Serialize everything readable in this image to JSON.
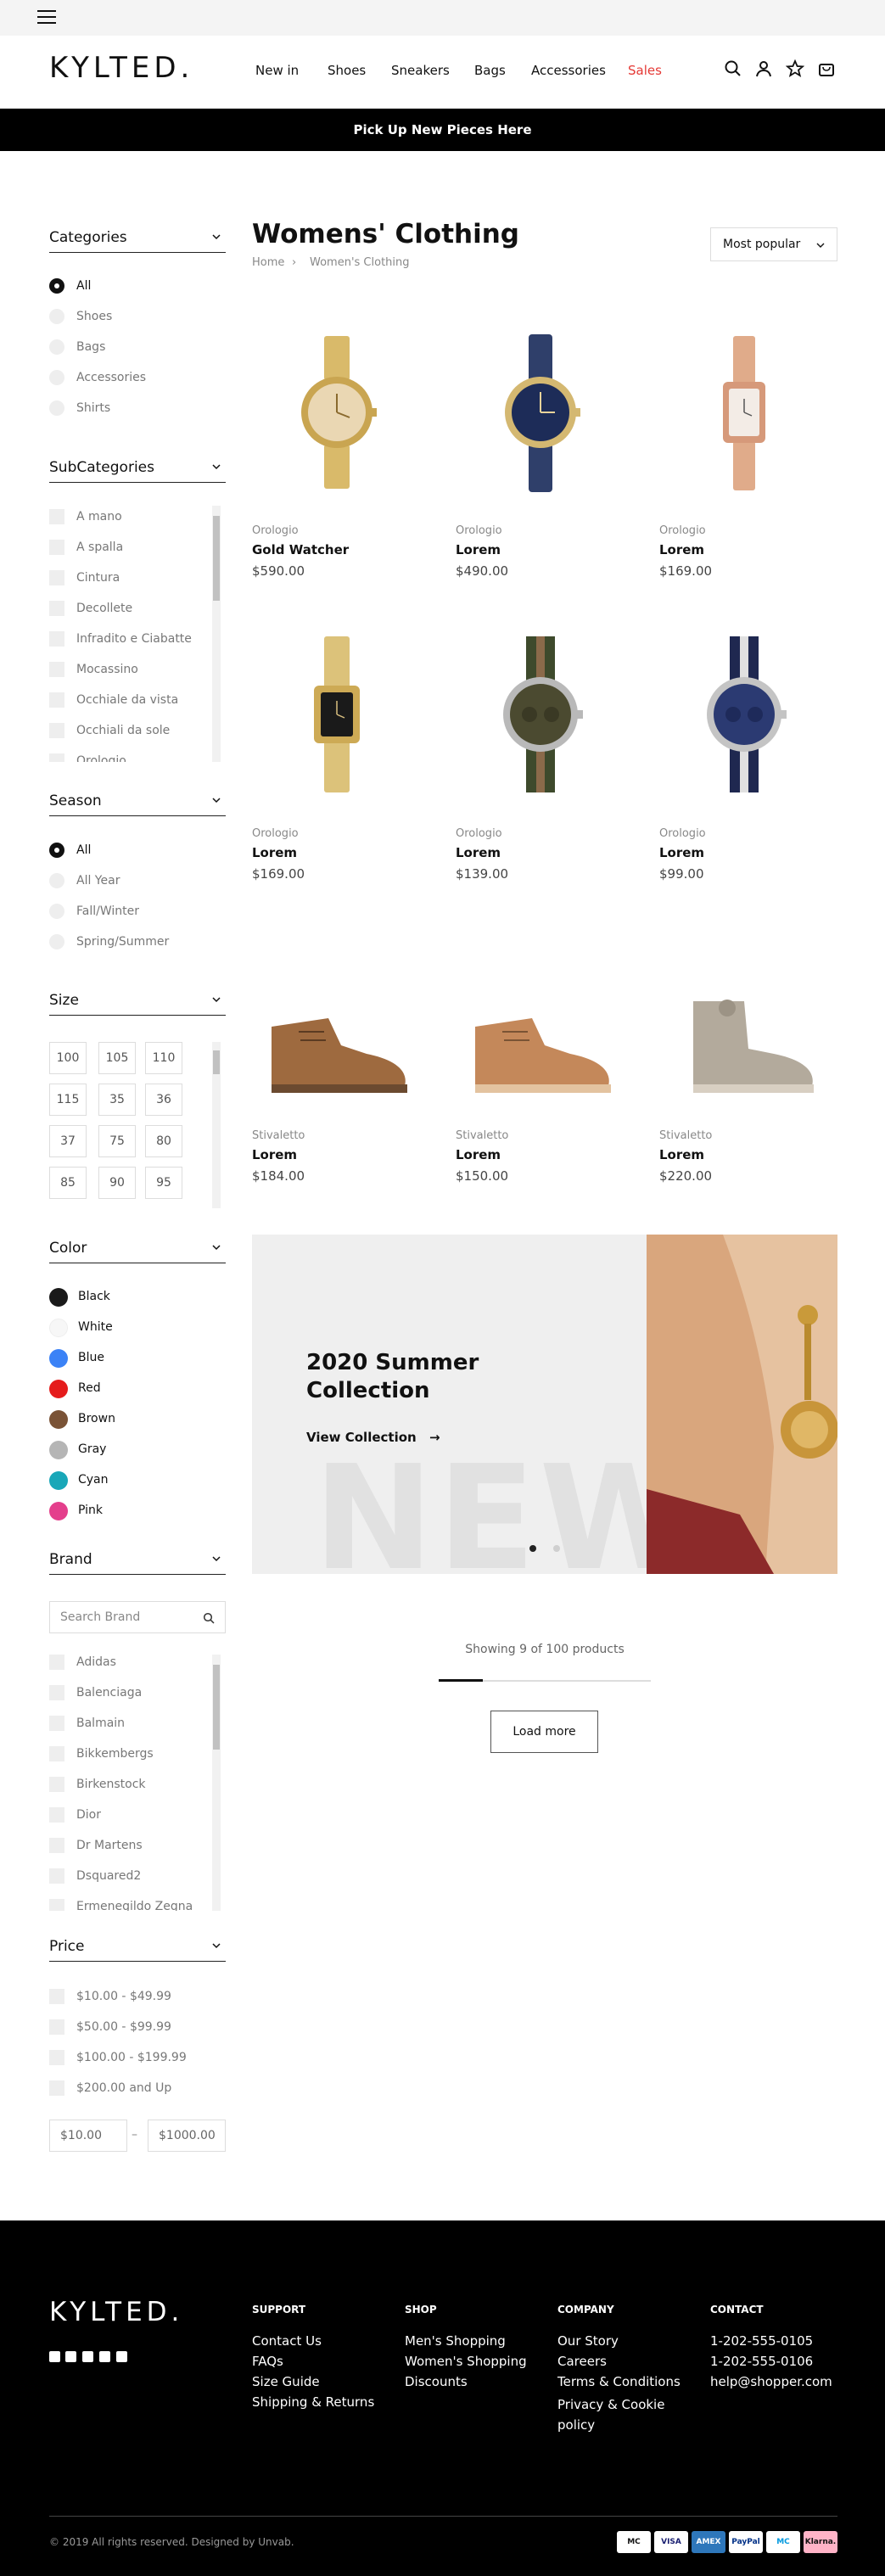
{
  "brand": {
    "logo": "KYLTED."
  },
  "nav": {
    "items": [
      "New in",
      "Shoes",
      "Sneakers",
      "Bags",
      "Accessories"
    ],
    "sales": "Sales",
    "sales_color": "#e53935"
  },
  "header_icons": [
    "search-icon",
    "user-icon",
    "star-icon",
    "bag-icon"
  ],
  "promo": {
    "text": "Pick Up New Pieces Here"
  },
  "filters": {
    "categories": {
      "title": "Categories",
      "options": [
        "All",
        "Shoes",
        "Bags",
        "Accessories",
        "Shirts"
      ],
      "selected": "All"
    },
    "subcategories": {
      "title": "SubCategories",
      "options": [
        "A mano",
        "A spalla",
        "Cintura",
        "Decollete",
        "Infradito e Ciabatte",
        "Mocassino",
        "Occhiale da vista",
        "Occhiali da sole",
        "Orologio"
      ]
    },
    "season": {
      "title": "Season",
      "options": [
        "All",
        "All Year",
        "Fall/Winter",
        "Spring/Summer"
      ],
      "selected": "All"
    },
    "size": {
      "title": "Size",
      "options": [
        "100",
        "105",
        "110",
        "115",
        "35",
        "36",
        "37",
        "75",
        "80",
        "85",
        "90",
        "95"
      ]
    },
    "color": {
      "title": "Color",
      "options": [
        {
          "label": "Black",
          "hex": "#1a1a1a"
        },
        {
          "label": "White",
          "hex": "#f7f7f7"
        },
        {
          "label": "Blue",
          "hex": "#3b82f6"
        },
        {
          "label": "Red",
          "hex": "#e51c1c"
        },
        {
          "label": "Brown",
          "hex": "#7a5336"
        },
        {
          "label": "Gray",
          "hex": "#b5b5b5"
        },
        {
          "label": "Cyan",
          "hex": "#19a7b8"
        },
        {
          "label": "Pink",
          "hex": "#e43f8c"
        }
      ]
    },
    "brand": {
      "title": "Brand",
      "search_placeholder": "Search Brand",
      "options": [
        "Adidas",
        "Balenciaga",
        "Balmain",
        "Bikkembergs",
        "Birkenstock",
        "Dior",
        "Dr Martens",
        "Dsquared2",
        "Ermenegildo Zegna"
      ]
    },
    "price": {
      "title": "Price",
      "options": [
        "$10.00 - $49.99",
        "$50.00 - $99.99",
        "$100.00 - $199.99",
        "$200.00 and Up"
      ],
      "min_value": "$10.00",
      "max_value": "$1000.00",
      "separator": "–"
    }
  },
  "page": {
    "title": "Womens' Clothing",
    "breadcrumb": [
      "Home",
      "Women's Clothing"
    ],
    "sort": "Most popular"
  },
  "products": [
    {
      "category": "Orologio",
      "name": "Gold Watcher",
      "price": "$590.00"
    },
    {
      "category": "Orologio",
      "name": "Lorem",
      "price": "$490.00"
    },
    {
      "category": "Orologio",
      "name": "Lorem",
      "price": "$169.00"
    },
    {
      "category": "Orologio",
      "name": "Lorem",
      "price": "$169.00"
    },
    {
      "category": "Orologio",
      "name": "Lorem",
      "price": "$139.00"
    },
    {
      "category": "Orologio",
      "name": "Lorem",
      "price": "$99.00"
    },
    {
      "category": "Stivaletto",
      "name": "Lorem",
      "price": "$184.00"
    },
    {
      "category": "Stivaletto",
      "name": "Lorem",
      "price": "$150.00"
    },
    {
      "category": "Stivaletto",
      "name": "Lorem",
      "price": "$220.00"
    }
  ],
  "banner": {
    "title": "2020 Summer Collection",
    "cta": "View Collection",
    "watermark": "NEW",
    "slides": 2,
    "active_slide": 1
  },
  "pagination": {
    "showing": "Showing 9 of 100 products",
    "progress": 0.09,
    "load_more": "Load more"
  },
  "footer": {
    "logo": "KYLTED.",
    "social": [
      "facebook-icon",
      "youtube-icon",
      "twitter-icon",
      "instagram-icon",
      "medium-icon"
    ],
    "columns": [
      {
        "title": "SUPPORT",
        "links": [
          "Contact Us",
          "FAQs",
          "Size Guide",
          "Shipping & Returns"
        ]
      },
      {
        "title": "SHOP",
        "links": [
          "Men's Shopping",
          "Women's Shopping",
          "Discounts"
        ]
      },
      {
        "title": "COMPANY",
        "links": [
          "Our Story",
          "Careers",
          "Terms & Conditions",
          "Privacy & Cookie policy"
        ]
      },
      {
        "title": "CONTACT",
        "links": [
          "1-202-555-0105",
          "1-202-555-0106",
          "help@shopper.com"
        ]
      }
    ],
    "copyright": "© 2019 All rights reserved. Designed by Unvab.",
    "payments": [
      "MC",
      "VISA",
      "AMEX",
      "PayPal",
      "MC",
      "Klarna."
    ]
  }
}
